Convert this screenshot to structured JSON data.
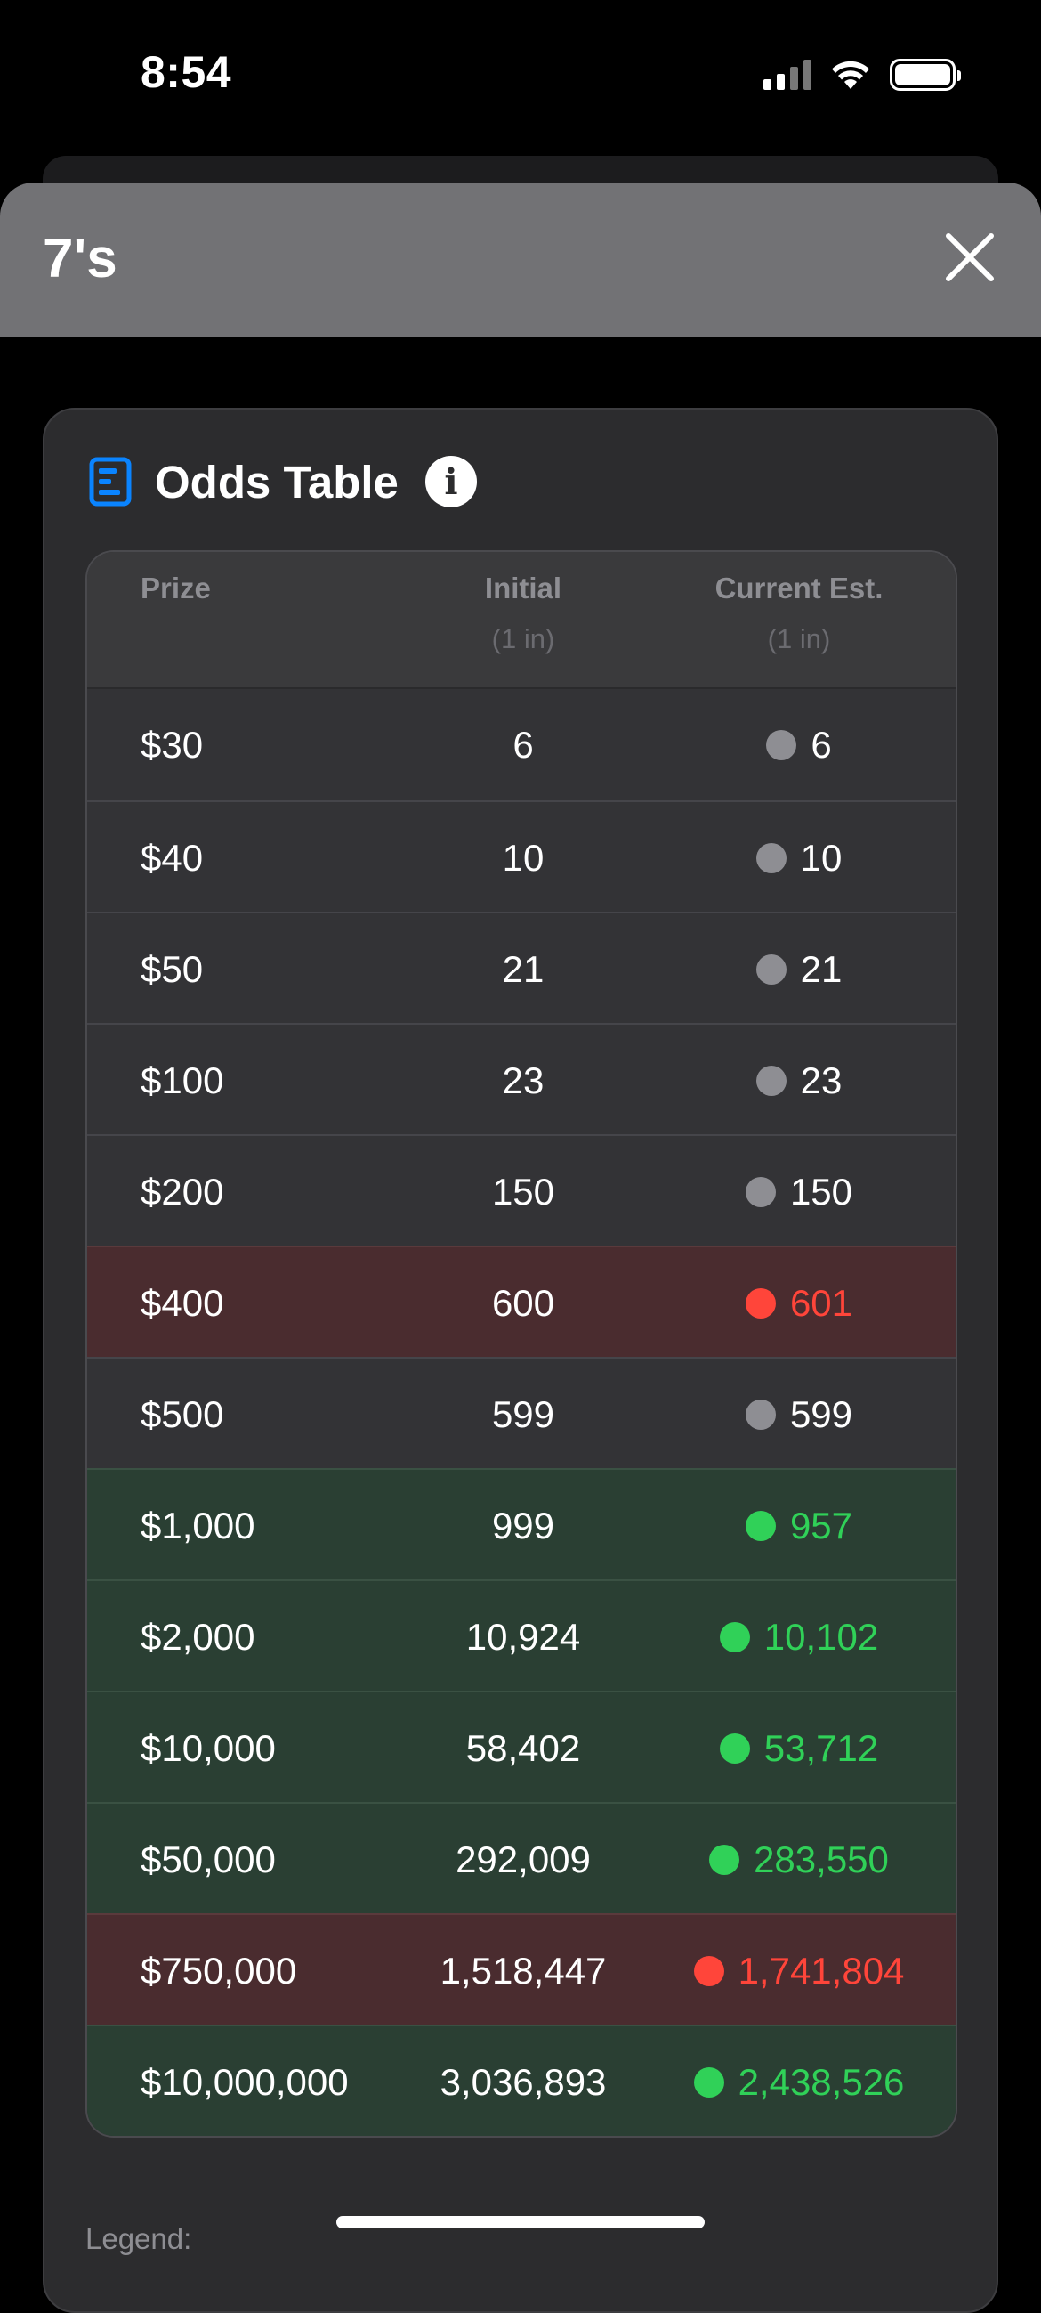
{
  "status_bar": {
    "time": "8:54",
    "icons": [
      "cellular-signal-icon",
      "wifi-icon",
      "battery-icon"
    ]
  },
  "sheet": {
    "title": "7's",
    "close_icon": "close-icon"
  },
  "card": {
    "icon": "table-icon",
    "title": "Odds Table",
    "info_glyph": "i",
    "legend_label": "Legend:"
  },
  "table": {
    "headers": {
      "prize": "Prize",
      "initial": "Initial",
      "initial_sub": "(1 in)",
      "current": "Current Est.",
      "current_sub": "(1 in)"
    },
    "rows": [
      {
        "prize": "$30",
        "initial": "6",
        "current": "6",
        "status": "neutral"
      },
      {
        "prize": "$40",
        "initial": "10",
        "current": "10",
        "status": "neutral"
      },
      {
        "prize": "$50",
        "initial": "21",
        "current": "21",
        "status": "neutral"
      },
      {
        "prize": "$100",
        "initial": "23",
        "current": "23",
        "status": "neutral"
      },
      {
        "prize": "$200",
        "initial": "150",
        "current": "150",
        "status": "neutral"
      },
      {
        "prize": "$400",
        "initial": "600",
        "current": "601",
        "status": "worse"
      },
      {
        "prize": "$500",
        "initial": "599",
        "current": "599",
        "status": "neutral"
      },
      {
        "prize": "$1,000",
        "initial": "999",
        "current": "957",
        "status": "better"
      },
      {
        "prize": "$2,000",
        "initial": "10,924",
        "current": "10,102",
        "status": "better"
      },
      {
        "prize": "$10,000",
        "initial": "58,402",
        "current": "53,712",
        "status": "better"
      },
      {
        "prize": "$50,000",
        "initial": "292,009",
        "current": "283,550",
        "status": "better"
      },
      {
        "prize": "$750,000",
        "initial": "1,518,447",
        "current": "1,741,804",
        "status": "worse"
      },
      {
        "prize": "$10,000,000",
        "initial": "3,036,893",
        "current": "2,438,526",
        "status": "better"
      }
    ]
  },
  "colors": {
    "header_bg": "#727275",
    "card_bg": "#2c2c2e",
    "neutral_dot": "#8e8e93",
    "worse": "#ff453a",
    "better": "#30d158",
    "worse_row_bg": "#4a2c2f",
    "better_row_bg": "#2a3f33",
    "accent_icon": "#0a84ff"
  }
}
